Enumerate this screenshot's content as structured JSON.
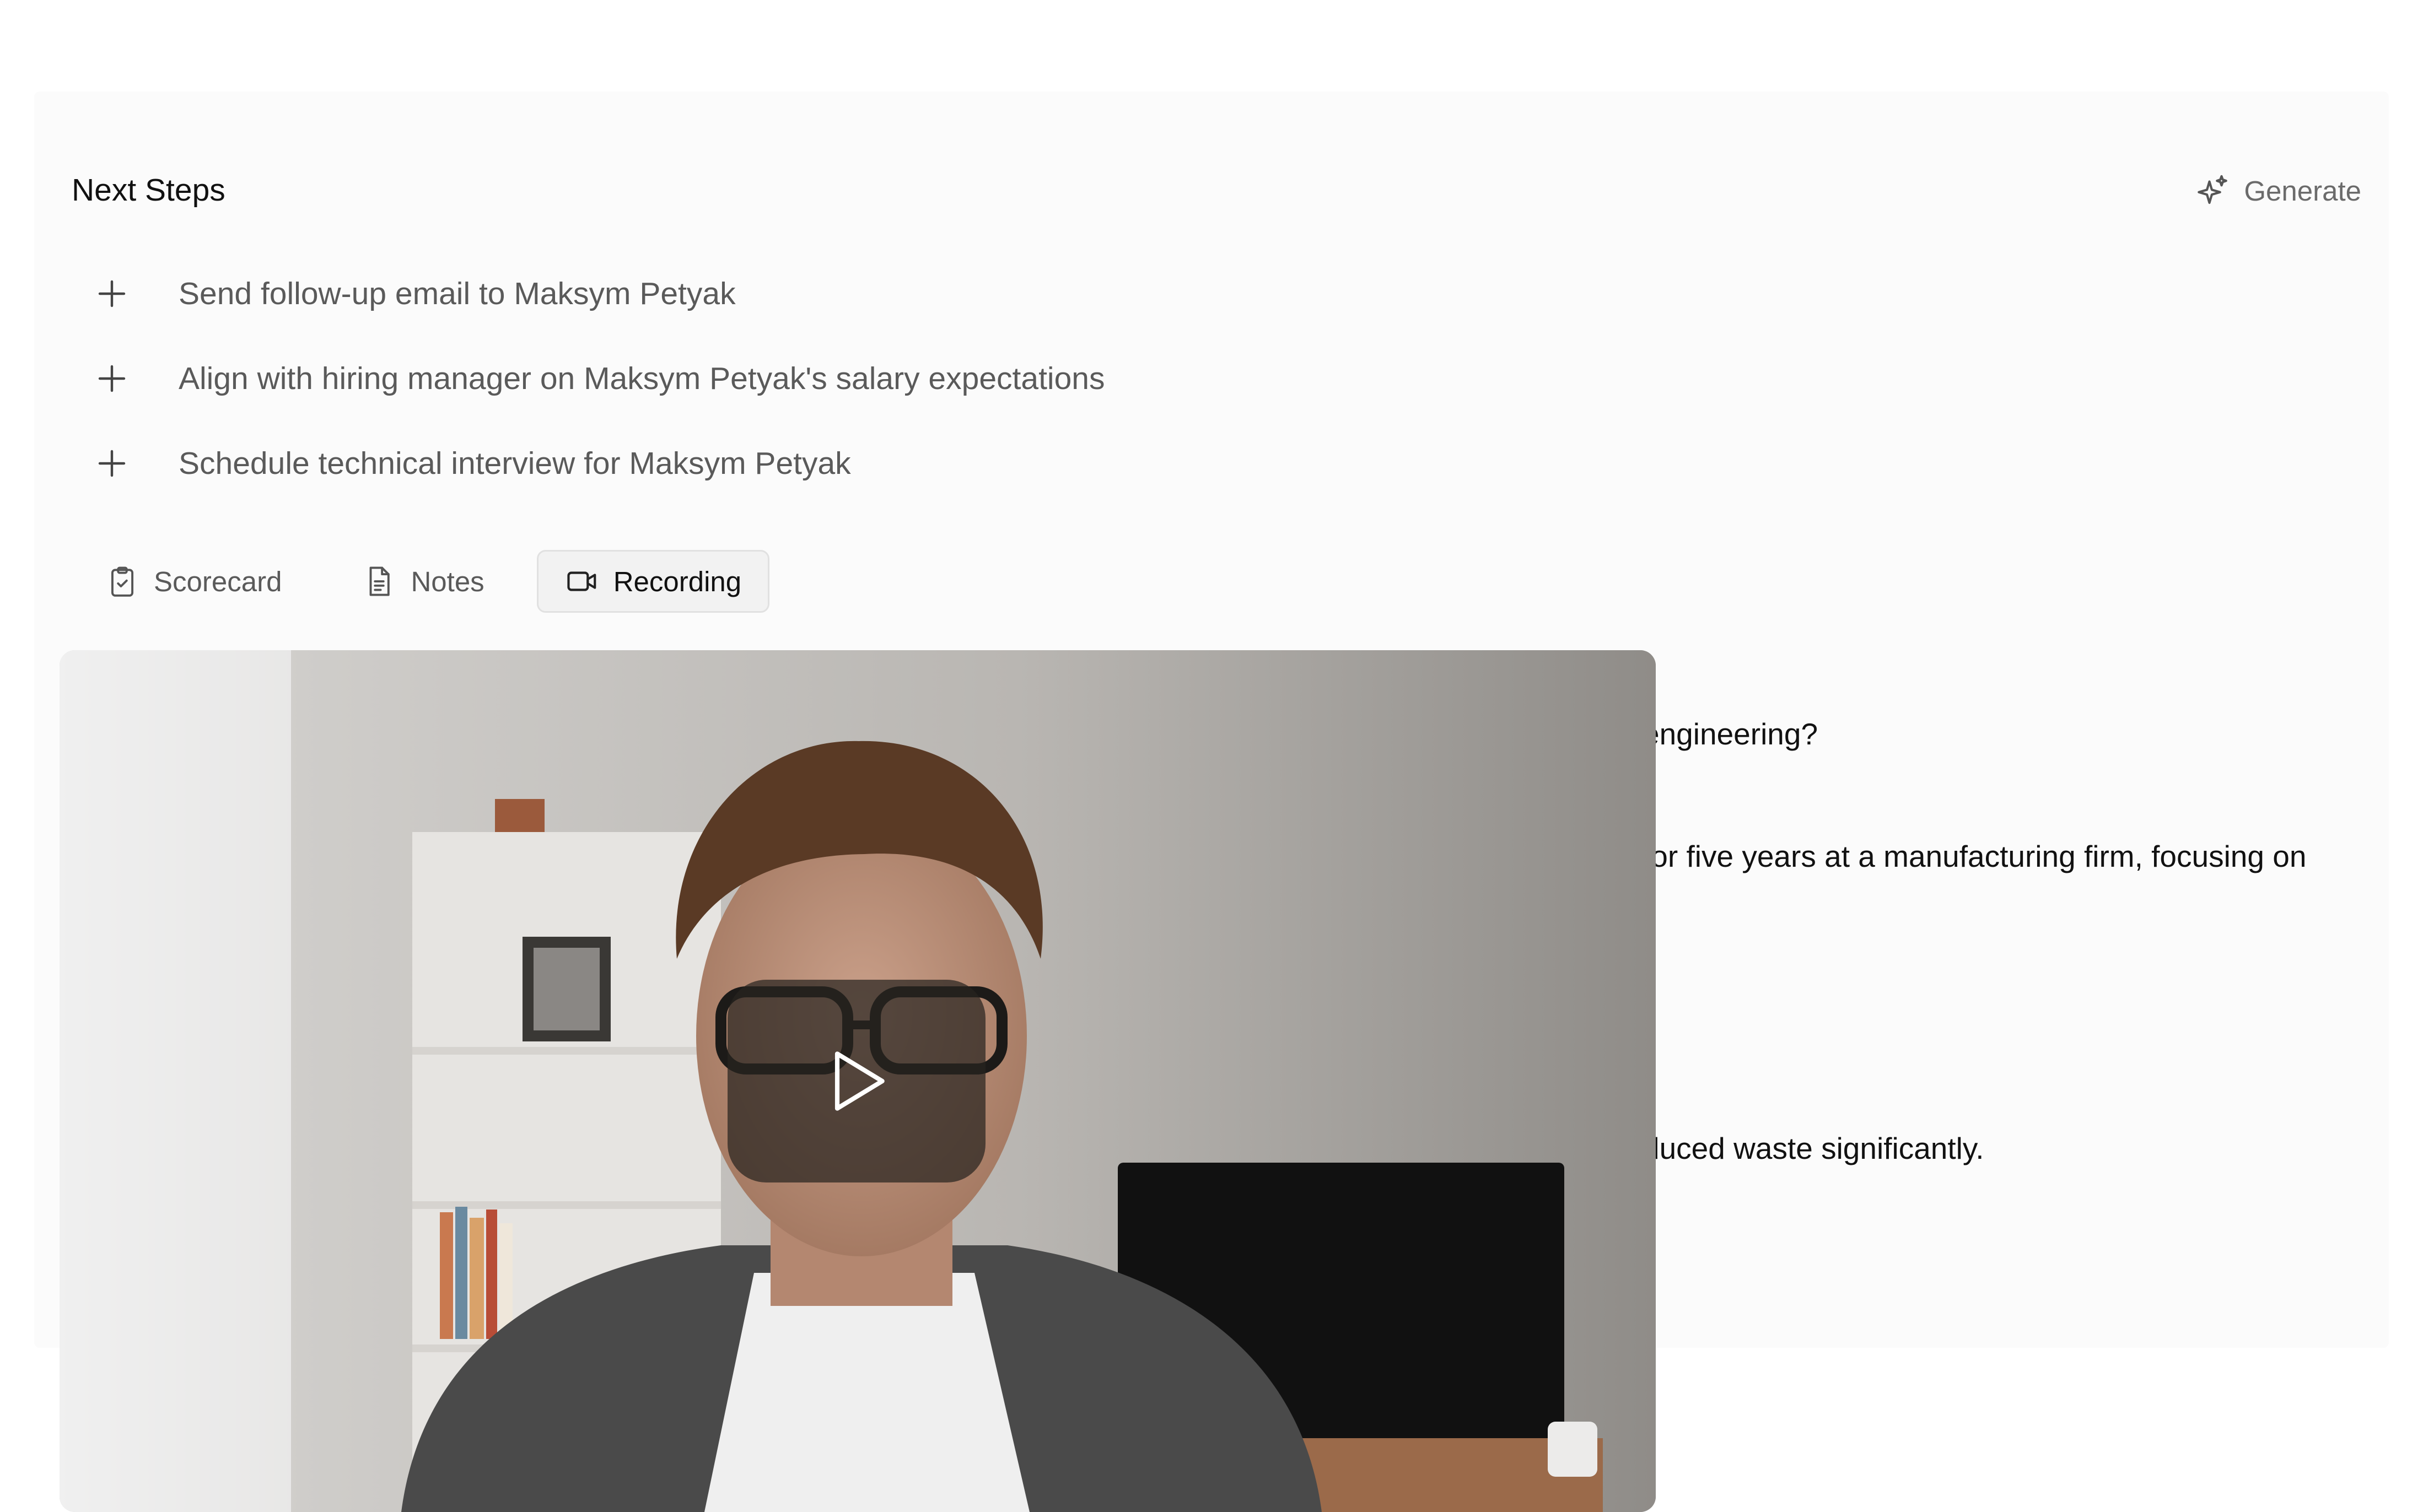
{
  "next_steps": {
    "title": "Next Steps",
    "generate_label": "Generate",
    "items": [
      {
        "label": "Send follow-up email to Maksym Petyak"
      },
      {
        "label": "Align with hiring manager on Maksym Petyak's salary expectations"
      },
      {
        "label": "Schedule technical interview for Maksym Petyak"
      }
    ]
  },
  "tabs": [
    {
      "label": "Scorecard",
      "icon": "clipboard-check-icon",
      "active": false
    },
    {
      "label": "Notes",
      "icon": "document-icon",
      "active": false
    },
    {
      "label": "Recording",
      "icon": "video-camera-icon",
      "active": true
    }
  ],
  "transcript": {
    "visible_fragments": [
      "engineering?",
      " for five years at a manufacturing firm, focusing on",
      "duced waste significantly."
    ]
  },
  "video": {
    "play_icon": "play-icon"
  },
  "colors": {
    "panel_bg": "#fbfbfb",
    "muted_text": "#5a5a5a",
    "active_tab_bg": "#f2f2f2"
  }
}
